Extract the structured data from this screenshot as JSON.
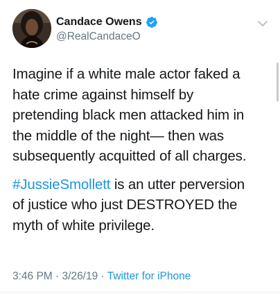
{
  "author": {
    "display_name": "Candace Owens",
    "handle": "@RealCandaceO",
    "verified": true,
    "avatar_icon": "profile-photo"
  },
  "tweet": {
    "lines": [
      "Imagine if a white male actor faked a",
      "hate crime against himself by",
      "pretending black men attacked him in",
      "the middle of the night— then was",
      "subsequently acquitted of all charges."
    ],
    "hashtag": "#JussieSmollett",
    "line2_rest": " is an utter perversion",
    "lines2": [
      "of justice who just DESTROYED the",
      "myth of white privilege."
    ]
  },
  "meta": {
    "time": "3:46 PM",
    "sep1": " · ",
    "date": "3/26/19",
    "sep2": " · ",
    "source": "Twitter for iPhone"
  },
  "colors": {
    "link": "#1b95e0",
    "text": "#14171a",
    "secondary": "#657786",
    "verified": "#1da1f2"
  },
  "icons": {
    "verified": "verified-badge-icon",
    "menu": "chevron-down-icon"
  }
}
